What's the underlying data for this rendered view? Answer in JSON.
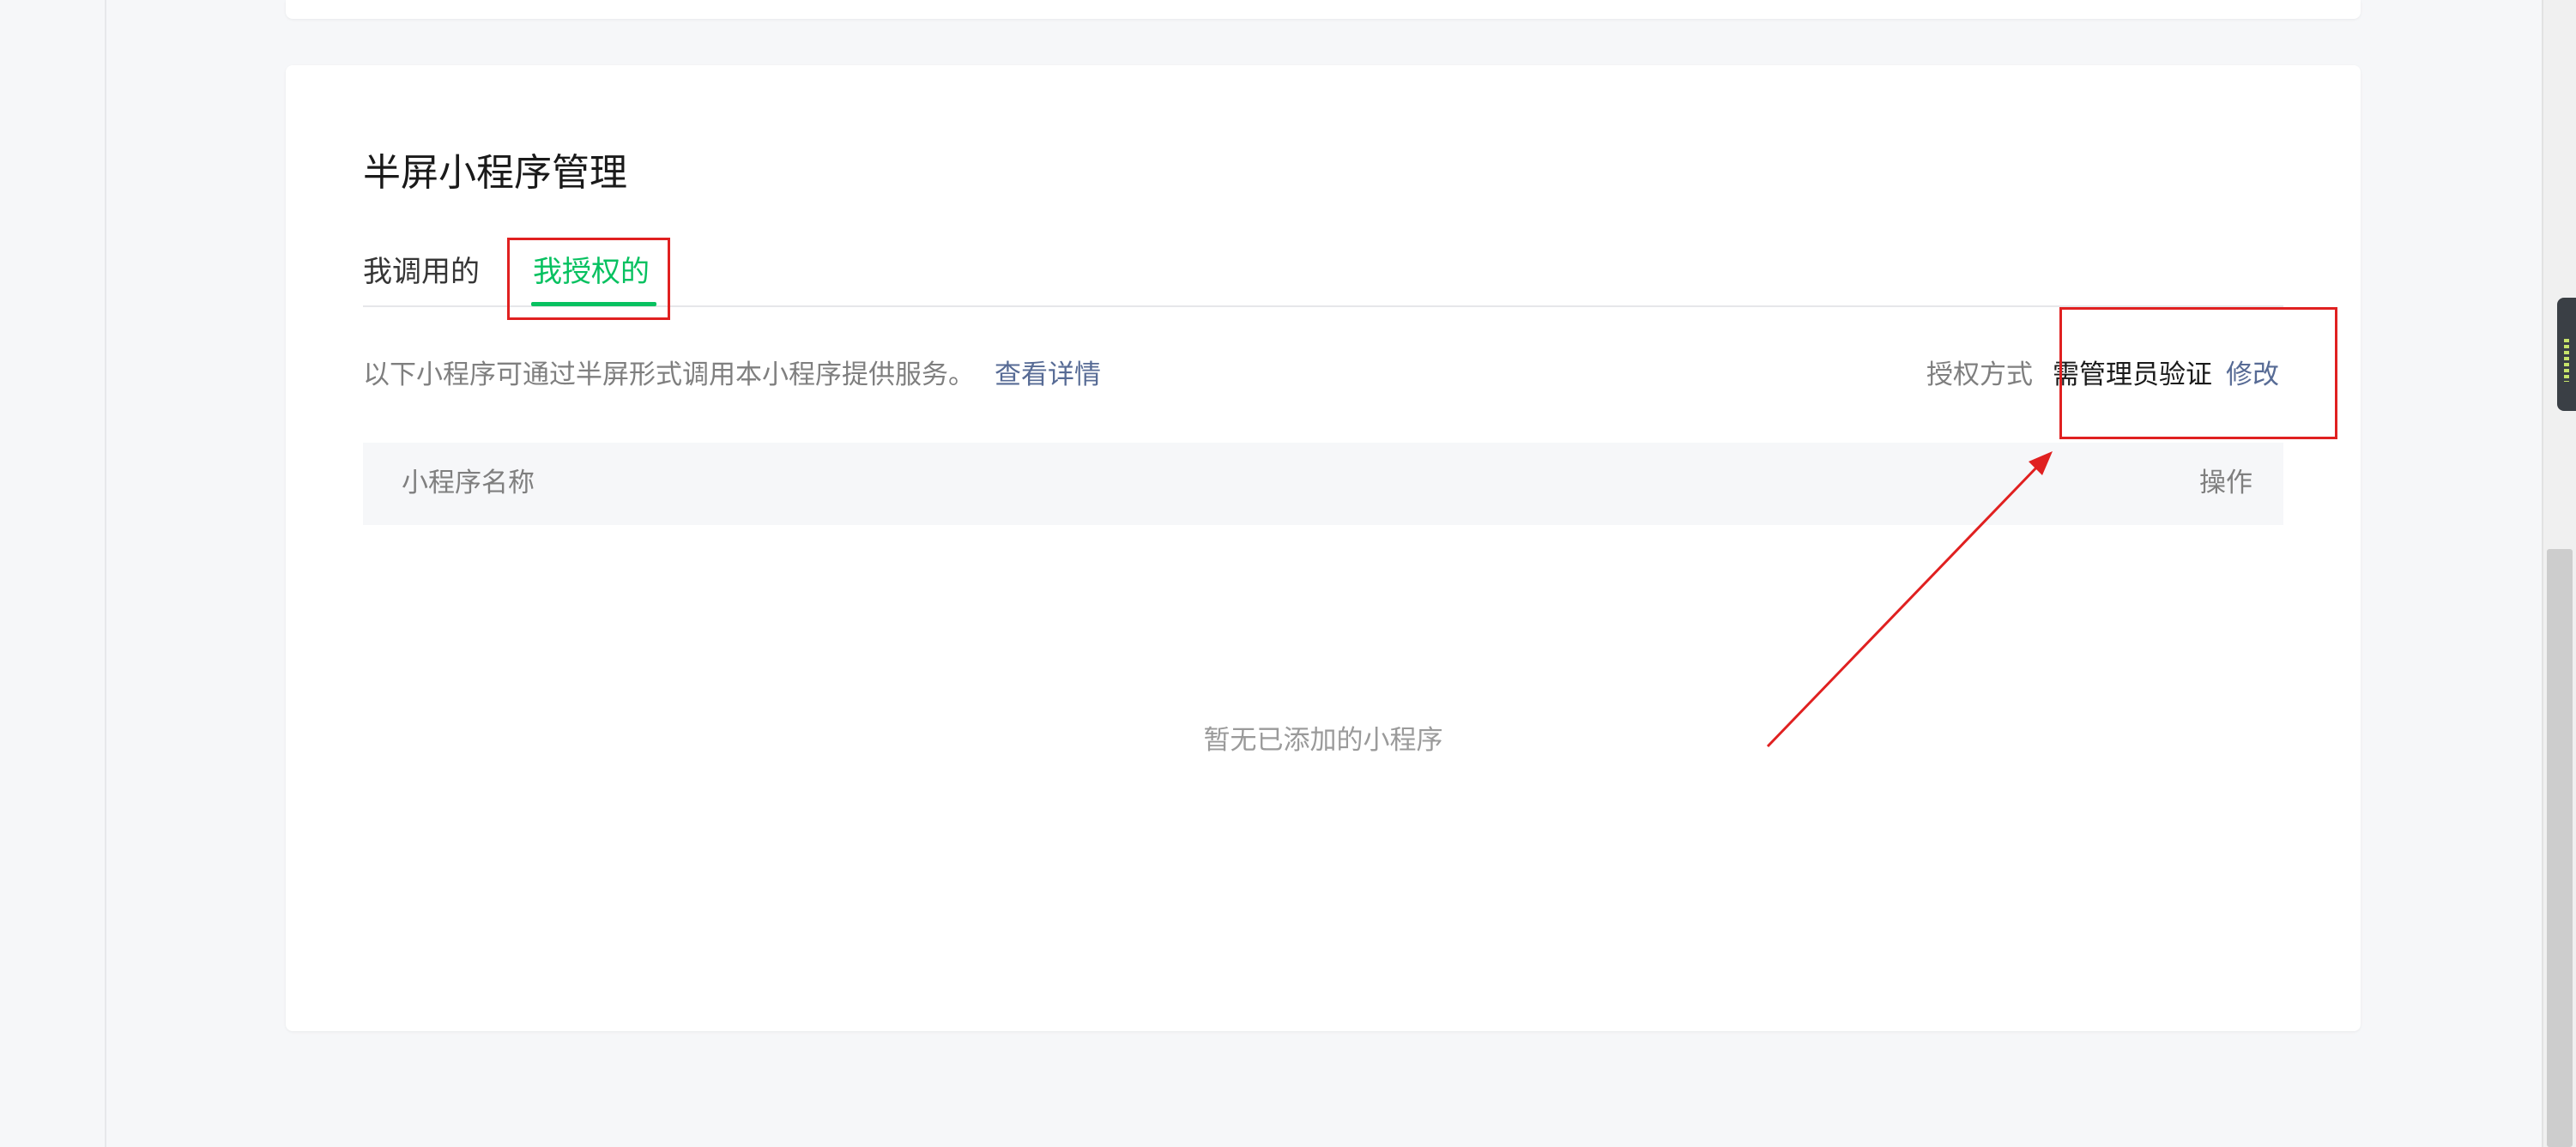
{
  "section": {
    "title": "半屏小程序管理",
    "tabs": [
      {
        "label": "我调用的",
        "active": false
      },
      {
        "label": "我授权的",
        "active": true
      }
    ],
    "description": "以下小程序可通过半屏形式调用本小程序提供服务。",
    "details_link": "查看详情",
    "auth": {
      "label": "授权方式",
      "value": "需管理员验证",
      "modify": "修改"
    },
    "table": {
      "columns": [
        "小程序名称",
        "操作"
      ]
    },
    "empty_text": "暂无已添加的小程序"
  },
  "colors": {
    "accent_green": "#07c160",
    "link_blue": "#576b95",
    "annotation_red": "#e02020"
  },
  "icons": {}
}
